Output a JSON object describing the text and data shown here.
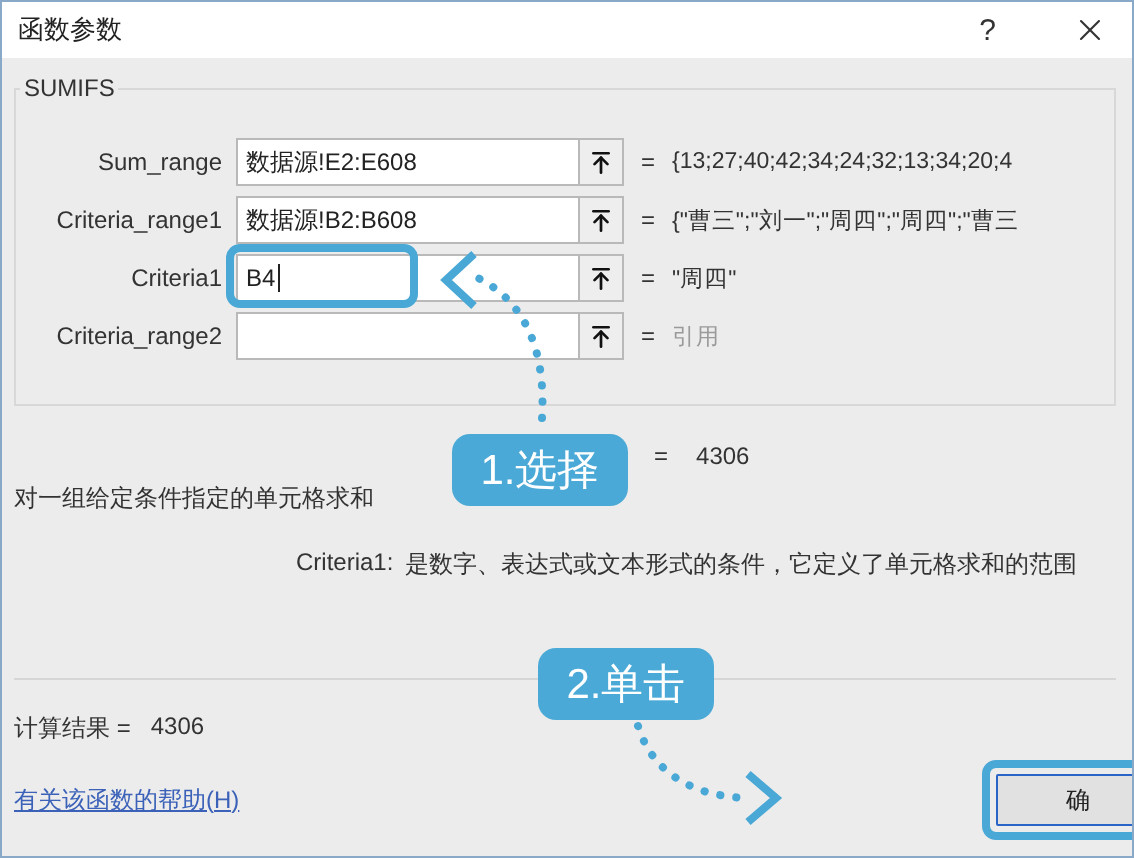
{
  "window": {
    "title": "函数参数",
    "help_button": "?"
  },
  "function_name": "SUMIFS",
  "arguments": [
    {
      "label": "Sum_range",
      "value": "数据源!E2:E608",
      "result": "{13;27;40;42;34;24;32;13;34;20;4",
      "dimmed": false,
      "highlighted": false
    },
    {
      "label": "Criteria_range1",
      "value": "数据源!B2:B608",
      "result": "{\"曹三\";\"刘一\";\"周四\";\"周四\";\"曹三",
      "dimmed": false,
      "highlighted": false
    },
    {
      "label": "Criteria1",
      "value": "B4",
      "result": "\"周四\"",
      "dimmed": false,
      "highlighted": true
    },
    {
      "label": "Criteria_range2",
      "result": "引用",
      "dimmed": true,
      "highlighted": false
    }
  ],
  "equals_sign": "=",
  "formula_result": {
    "sign": "=",
    "value": "4306"
  },
  "description": "对一组给定条件指定的单元格求和",
  "argument_help": {
    "name": "Criteria1:",
    "text": "是数字、表达式或文本形式的条件，它定义了单元格求和的范围"
  },
  "calculation": {
    "label": "计算结果 =",
    "value": "4306"
  },
  "help_link": "有关该函数的帮助(H)",
  "ok_button": {
    "label": "确",
    "highlighted": true
  },
  "callouts": [
    {
      "label": "1.选择"
    },
    {
      "label": "2.单击"
    }
  ]
}
